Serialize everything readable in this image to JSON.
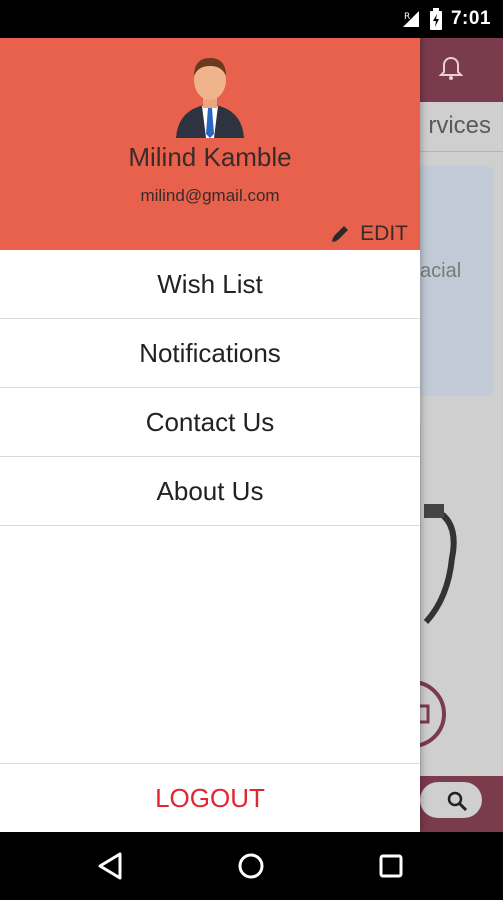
{
  "status_bar": {
    "time": "7:01"
  },
  "background_app": {
    "tab_label": "rvices",
    "card_text": "acial",
    "colors": {
      "topbar": "#7a3b4d"
    }
  },
  "drawer": {
    "user": {
      "name": "Milind Kamble",
      "email": "milind@gmail.com"
    },
    "edit_label": "EDIT",
    "menu": [
      {
        "label": "Wish List"
      },
      {
        "label": "Notifications"
      },
      {
        "label": "Contact Us"
      },
      {
        "label": "About Us"
      }
    ],
    "logout_label": "LOGOUT",
    "colors": {
      "header": "#e8614c",
      "logout": "#e2252f"
    }
  },
  "nav_bar": {
    "icons": [
      "back-icon",
      "home-icon",
      "recents-icon"
    ]
  }
}
